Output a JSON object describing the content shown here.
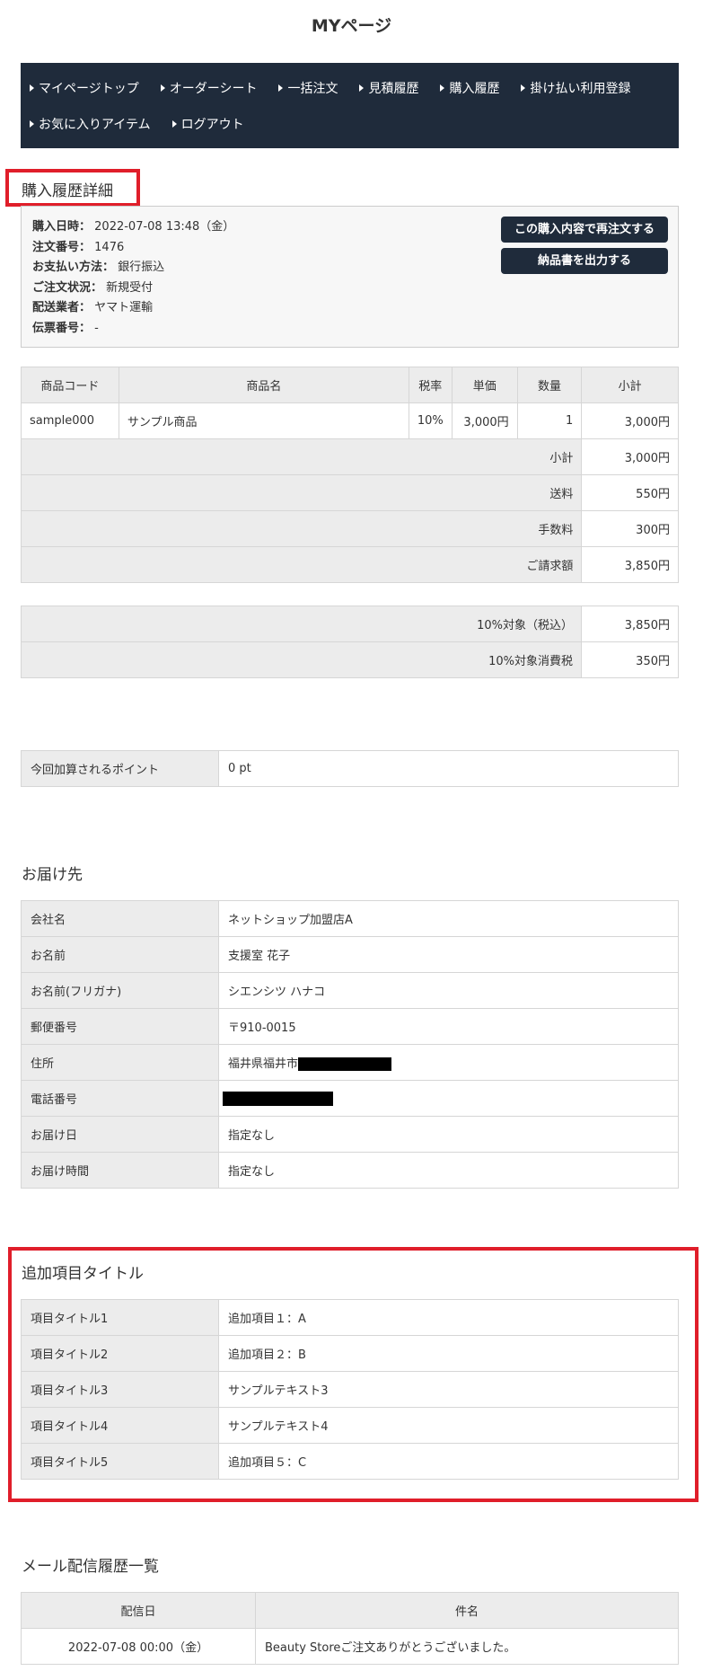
{
  "page": {
    "title": "MYページ"
  },
  "nav": {
    "row1": [
      "マイページトップ",
      "オーダーシート",
      "一括注文",
      "見積履歴",
      "購入履歴",
      "掛け払い利用登録"
    ],
    "row2": [
      "お気に入りアイテム",
      "ログアウト"
    ]
  },
  "detail": {
    "heading": "購入履歴詳細",
    "rows": [
      {
        "label": "購入日時：",
        "value": "2022-07-08 13:48（金）"
      },
      {
        "label": "注文番号：",
        "value": "1476"
      },
      {
        "label": "お支払い方法：",
        "value": "銀行振込"
      },
      {
        "label": "ご注文状況：",
        "value": "新規受付"
      },
      {
        "label": "配送業者：",
        "value": "ヤマト運輸"
      },
      {
        "label": "伝票番号：",
        "value": "-"
      }
    ],
    "reorder_button": "この購入内容で再注文する",
    "invoice_button": "納品書を出力する"
  },
  "items_table": {
    "headers": [
      "商品コード",
      "商品名",
      "税率",
      "単価",
      "数量",
      "小計"
    ],
    "row": {
      "code": "sample000",
      "name": "サンプル商品",
      "tax": "10%",
      "price": "3,000円",
      "qty": "1",
      "subtotal": "3,000円"
    },
    "totals": [
      {
        "label": "小計",
        "value": "3,000円"
      },
      {
        "label": "送料",
        "value": "550円"
      },
      {
        "label": "手数料",
        "value": "300円"
      },
      {
        "label": "ご請求額",
        "value": "3,850円"
      }
    ]
  },
  "tax_table": [
    {
      "label": "10%対象（税込）",
      "value": "3,850円"
    },
    {
      "label": "10%対象消費税",
      "value": "350円"
    }
  ],
  "points": {
    "label": "今回加算されるポイント",
    "value": "0 pt"
  },
  "delivery": {
    "heading": "お届け先",
    "rows": [
      {
        "label": "会社名",
        "value": "ネットショップ加盟店A"
      },
      {
        "label": "お名前",
        "value": "支援室 花子"
      },
      {
        "label": "お名前(フリガナ)",
        "value": "シエンシツ ハナコ"
      },
      {
        "label": "郵便番号",
        "value": "〒910-0015"
      },
      {
        "label": "住所",
        "value": "福井県福井市"
      },
      {
        "label": "電話番号",
        "value": ""
      },
      {
        "label": "お届け日",
        "value": "指定なし"
      },
      {
        "label": "お届け時間",
        "value": "指定なし"
      }
    ]
  },
  "extra": {
    "heading": "追加項目タイトル",
    "rows": [
      {
        "label": "項目タイトル1",
        "value": "追加項目１：A"
      },
      {
        "label": "項目タイトル2",
        "value": "追加項目２：B"
      },
      {
        "label": "項目タイトル3",
        "value": "サンプルテキスト3"
      },
      {
        "label": "項目タイトル4",
        "value": "サンプルテキスト4"
      },
      {
        "label": "項目タイトル5",
        "value": "追加項目５：C"
      }
    ]
  },
  "mail": {
    "heading": "メール配信履歴一覧",
    "headers": [
      "配信日",
      "件名"
    ],
    "rows": [
      {
        "date": "2022-07-08 00:00（金）",
        "subject": "Beauty Storeご注文ありがとうございました。"
      }
    ]
  }
}
